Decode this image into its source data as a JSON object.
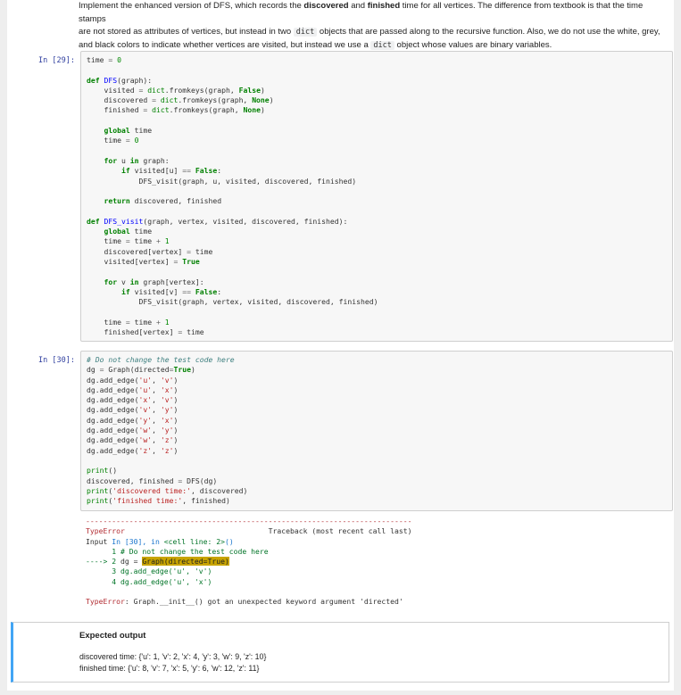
{
  "intro": {
    "line1_pre": "Implement the enhanced version of DFS, which records the ",
    "line1_b1": "discovered",
    "line1_mid": " and ",
    "line1_b2": "finished",
    "line1_post": " time for all vertices. The difference from textbook is that the time stamps",
    "line2_pre": "are not stored as attributes of vertices, but instead in two ",
    "line2_code": "dict",
    "line2_post": " objects that are passed along to the recursive function. Also, we do not use the white, grey,",
    "line3_pre": "and black colors to indicate whether vertices are visited, but instead we use a ",
    "line3_code": "dict",
    "line3_post": " object whose values are binary variables."
  },
  "cells": [
    {
      "prompt": "In [29]:"
    },
    {
      "prompt": "In [30]:"
    }
  ],
  "traceback": {
    "rule": "---------------------------------------------------------------------------",
    "error_name": "TypeError",
    "traceback_label": "Traceback (most recent call last)",
    "input_line_pre": "Input ",
    "input_line_in": "In [30], in ",
    "input_line_cell": "<cell line: 2>",
    "input_line_post": "()",
    "l1": "      1 # Do not change the test code here",
    "l2_arrow": "----> 2 ",
    "l2_code_pre": "dg = ",
    "l2_highlight": "Graph(directed=True)",
    "l3": "      3 dg.add_edge('u', 'v')",
    "l4": "      4 dg.add_edge('u', 'x')",
    "final_name": "TypeError",
    "final_msg": ": Graph.__init__() got an unexpected keyword argument 'directed'"
  },
  "expected": {
    "title": "Expected output",
    "discovered": "discovered time: {'u': 1, 'v': 2, 'x': 4, 'y': 3, 'w': 9, 'z': 10}",
    "finished": "finished time: {'u': 8, 'v': 7, 'x': 5, 'y': 6, 'w': 12, 'z': 11}"
  }
}
